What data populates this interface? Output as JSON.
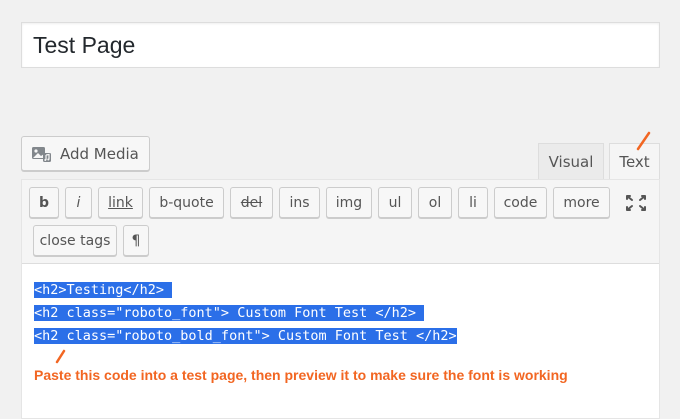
{
  "title": {
    "value": "Test Page"
  },
  "media": {
    "add_label": "Add Media"
  },
  "tabs": {
    "visual": "Visual",
    "text": "Text"
  },
  "toolbar": {
    "buttons": [
      "b",
      "i",
      "link",
      "b-quote",
      "del",
      "ins",
      "img",
      "ul",
      "ol",
      "li",
      "code",
      "more",
      "close tags",
      "¶"
    ]
  },
  "editor": {
    "lines": [
      "<h2>Testing</h2> ",
      "<h2 class=\"roboto_font\"> Custom Font Test </h2> ",
      "<h2 class=\"roboto_bold_font\"> Custom Font Test </h2>"
    ]
  },
  "annotation": {
    "text": "Paste this code into a test page, then preview it to make sure the font is working",
    "color": "#f26622"
  },
  "colors": {
    "selection": "#2b6fe8",
    "accent": "#f26622"
  }
}
